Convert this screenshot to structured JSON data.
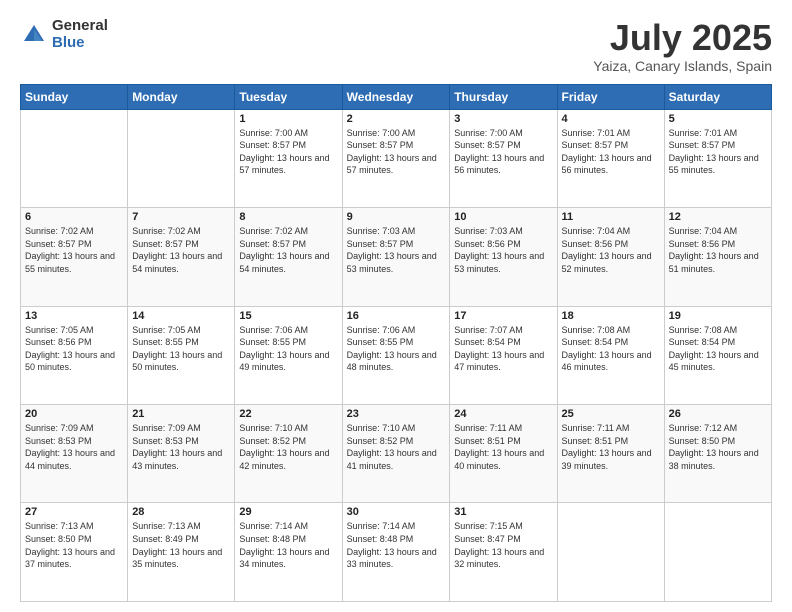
{
  "header": {
    "logo_general": "General",
    "logo_blue": "Blue",
    "title": "July 2025",
    "location": "Yaiza, Canary Islands, Spain"
  },
  "days_of_week": [
    "Sunday",
    "Monday",
    "Tuesday",
    "Wednesday",
    "Thursday",
    "Friday",
    "Saturday"
  ],
  "weeks": [
    [
      {
        "day": "",
        "sunrise": "",
        "sunset": "",
        "daylight": ""
      },
      {
        "day": "",
        "sunrise": "",
        "sunset": "",
        "daylight": ""
      },
      {
        "day": "1",
        "sunrise": "Sunrise: 7:00 AM",
        "sunset": "Sunset: 8:57 PM",
        "daylight": "Daylight: 13 hours and 57 minutes."
      },
      {
        "day": "2",
        "sunrise": "Sunrise: 7:00 AM",
        "sunset": "Sunset: 8:57 PM",
        "daylight": "Daylight: 13 hours and 57 minutes."
      },
      {
        "day": "3",
        "sunrise": "Sunrise: 7:00 AM",
        "sunset": "Sunset: 8:57 PM",
        "daylight": "Daylight: 13 hours and 56 minutes."
      },
      {
        "day": "4",
        "sunrise": "Sunrise: 7:01 AM",
        "sunset": "Sunset: 8:57 PM",
        "daylight": "Daylight: 13 hours and 56 minutes."
      },
      {
        "day": "5",
        "sunrise": "Sunrise: 7:01 AM",
        "sunset": "Sunset: 8:57 PM",
        "daylight": "Daylight: 13 hours and 55 minutes."
      }
    ],
    [
      {
        "day": "6",
        "sunrise": "Sunrise: 7:02 AM",
        "sunset": "Sunset: 8:57 PM",
        "daylight": "Daylight: 13 hours and 55 minutes."
      },
      {
        "day": "7",
        "sunrise": "Sunrise: 7:02 AM",
        "sunset": "Sunset: 8:57 PM",
        "daylight": "Daylight: 13 hours and 54 minutes."
      },
      {
        "day": "8",
        "sunrise": "Sunrise: 7:02 AM",
        "sunset": "Sunset: 8:57 PM",
        "daylight": "Daylight: 13 hours and 54 minutes."
      },
      {
        "day": "9",
        "sunrise": "Sunrise: 7:03 AM",
        "sunset": "Sunset: 8:57 PM",
        "daylight": "Daylight: 13 hours and 53 minutes."
      },
      {
        "day": "10",
        "sunrise": "Sunrise: 7:03 AM",
        "sunset": "Sunset: 8:56 PM",
        "daylight": "Daylight: 13 hours and 53 minutes."
      },
      {
        "day": "11",
        "sunrise": "Sunrise: 7:04 AM",
        "sunset": "Sunset: 8:56 PM",
        "daylight": "Daylight: 13 hours and 52 minutes."
      },
      {
        "day": "12",
        "sunrise": "Sunrise: 7:04 AM",
        "sunset": "Sunset: 8:56 PM",
        "daylight": "Daylight: 13 hours and 51 minutes."
      }
    ],
    [
      {
        "day": "13",
        "sunrise": "Sunrise: 7:05 AM",
        "sunset": "Sunset: 8:56 PM",
        "daylight": "Daylight: 13 hours and 50 minutes."
      },
      {
        "day": "14",
        "sunrise": "Sunrise: 7:05 AM",
        "sunset": "Sunset: 8:55 PM",
        "daylight": "Daylight: 13 hours and 50 minutes."
      },
      {
        "day": "15",
        "sunrise": "Sunrise: 7:06 AM",
        "sunset": "Sunset: 8:55 PM",
        "daylight": "Daylight: 13 hours and 49 minutes."
      },
      {
        "day": "16",
        "sunrise": "Sunrise: 7:06 AM",
        "sunset": "Sunset: 8:55 PM",
        "daylight": "Daylight: 13 hours and 48 minutes."
      },
      {
        "day": "17",
        "sunrise": "Sunrise: 7:07 AM",
        "sunset": "Sunset: 8:54 PM",
        "daylight": "Daylight: 13 hours and 47 minutes."
      },
      {
        "day": "18",
        "sunrise": "Sunrise: 7:08 AM",
        "sunset": "Sunset: 8:54 PM",
        "daylight": "Daylight: 13 hours and 46 minutes."
      },
      {
        "day": "19",
        "sunrise": "Sunrise: 7:08 AM",
        "sunset": "Sunset: 8:54 PM",
        "daylight": "Daylight: 13 hours and 45 minutes."
      }
    ],
    [
      {
        "day": "20",
        "sunrise": "Sunrise: 7:09 AM",
        "sunset": "Sunset: 8:53 PM",
        "daylight": "Daylight: 13 hours and 44 minutes."
      },
      {
        "day": "21",
        "sunrise": "Sunrise: 7:09 AM",
        "sunset": "Sunset: 8:53 PM",
        "daylight": "Daylight: 13 hours and 43 minutes."
      },
      {
        "day": "22",
        "sunrise": "Sunrise: 7:10 AM",
        "sunset": "Sunset: 8:52 PM",
        "daylight": "Daylight: 13 hours and 42 minutes."
      },
      {
        "day": "23",
        "sunrise": "Sunrise: 7:10 AM",
        "sunset": "Sunset: 8:52 PM",
        "daylight": "Daylight: 13 hours and 41 minutes."
      },
      {
        "day": "24",
        "sunrise": "Sunrise: 7:11 AM",
        "sunset": "Sunset: 8:51 PM",
        "daylight": "Daylight: 13 hours and 40 minutes."
      },
      {
        "day": "25",
        "sunrise": "Sunrise: 7:11 AM",
        "sunset": "Sunset: 8:51 PM",
        "daylight": "Daylight: 13 hours and 39 minutes."
      },
      {
        "day": "26",
        "sunrise": "Sunrise: 7:12 AM",
        "sunset": "Sunset: 8:50 PM",
        "daylight": "Daylight: 13 hours and 38 minutes."
      }
    ],
    [
      {
        "day": "27",
        "sunrise": "Sunrise: 7:13 AM",
        "sunset": "Sunset: 8:50 PM",
        "daylight": "Daylight: 13 hours and 37 minutes."
      },
      {
        "day": "28",
        "sunrise": "Sunrise: 7:13 AM",
        "sunset": "Sunset: 8:49 PM",
        "daylight": "Daylight: 13 hours and 35 minutes."
      },
      {
        "day": "29",
        "sunrise": "Sunrise: 7:14 AM",
        "sunset": "Sunset: 8:48 PM",
        "daylight": "Daylight: 13 hours and 34 minutes."
      },
      {
        "day": "30",
        "sunrise": "Sunrise: 7:14 AM",
        "sunset": "Sunset: 8:48 PM",
        "daylight": "Daylight: 13 hours and 33 minutes."
      },
      {
        "day": "31",
        "sunrise": "Sunrise: 7:15 AM",
        "sunset": "Sunset: 8:47 PM",
        "daylight": "Daylight: 13 hours and 32 minutes."
      },
      {
        "day": "",
        "sunrise": "",
        "sunset": "",
        "daylight": ""
      },
      {
        "day": "",
        "sunrise": "",
        "sunset": "",
        "daylight": ""
      }
    ]
  ]
}
